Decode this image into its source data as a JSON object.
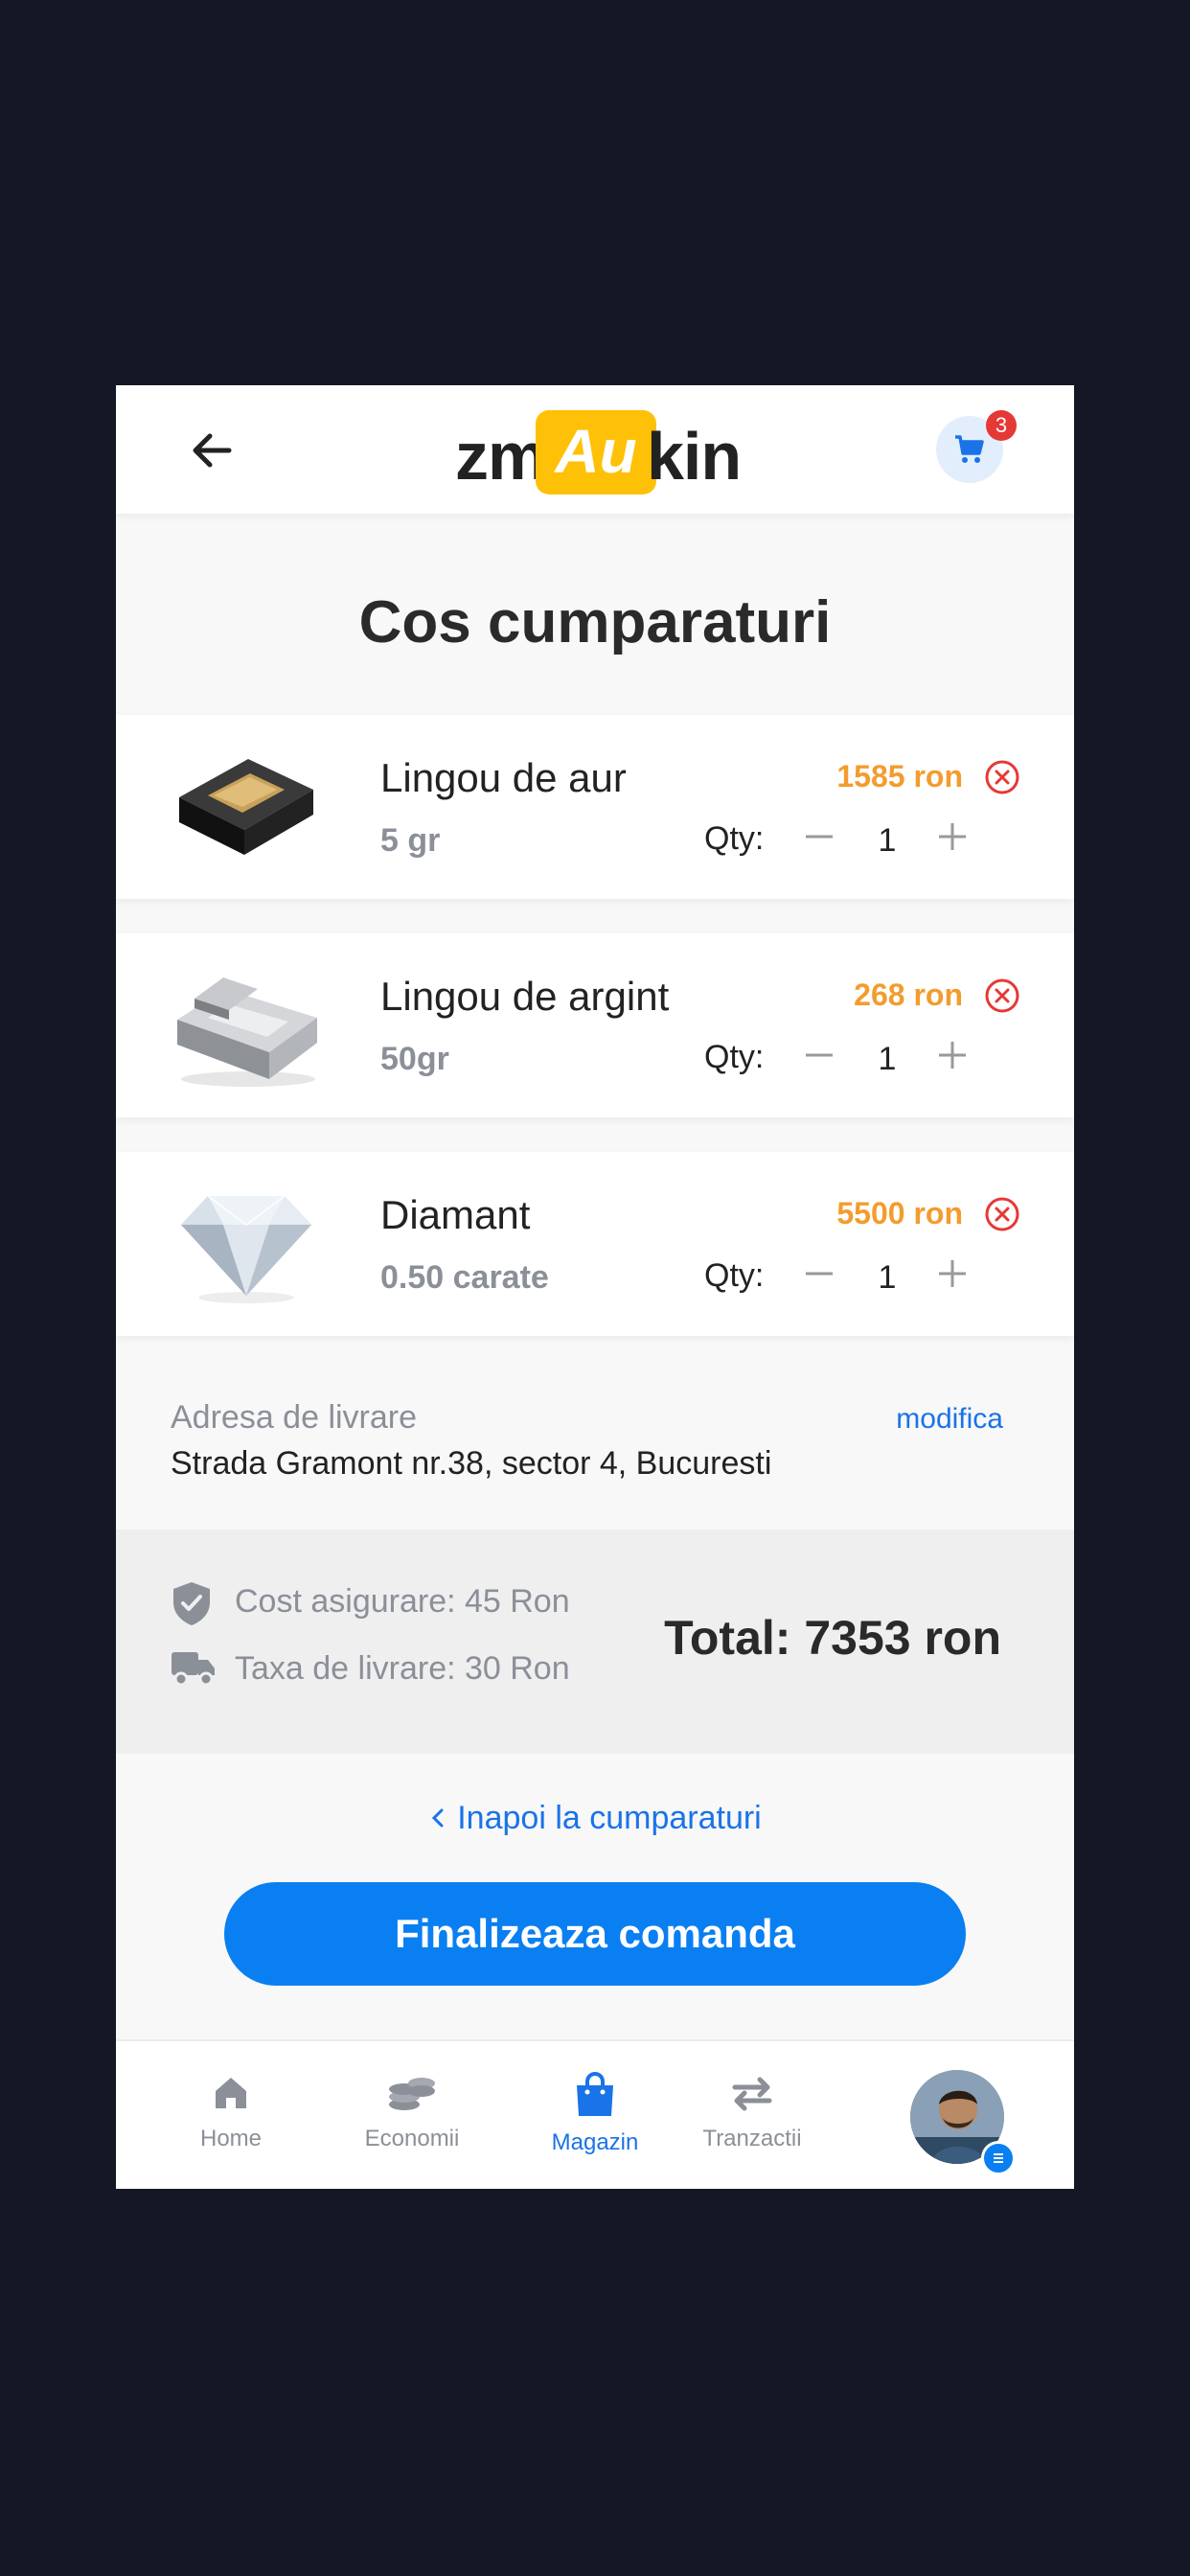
{
  "header": {
    "logo": {
      "left": "zm",
      "highlight": "Au",
      "right": "kin"
    },
    "cart_count": "3"
  },
  "page_title": "Cos cumparaturi",
  "cart_items": [
    {
      "name": "Lingou de aur",
      "detail": "5 gr",
      "price": "1585 ron",
      "qty_label": "Qty:",
      "qty": "1"
    },
    {
      "name": "Lingou de argint",
      "detail": "50gr",
      "price": "268 ron",
      "qty_label": "Qty:",
      "qty": "1"
    },
    {
      "name": "Diamant",
      "detail": "0.50 carate",
      "price": "5500 ron",
      "qty_label": "Qty:",
      "qty": "1"
    }
  ],
  "address": {
    "label": "Adresa de livrare",
    "edit_label": "modifica",
    "value": "Strada Gramont nr.38, sector 4, Bucuresti"
  },
  "summary": {
    "insurance": "Cost asigurare: 45 Ron",
    "delivery": "Taxa de livrare: 30 Ron",
    "total": "Total: 7353 ron"
  },
  "actions": {
    "back_link": "Inapoi la cumparaturi",
    "checkout": "Finalizeaza comanda"
  },
  "nav": [
    {
      "label": "Home",
      "icon": "home-icon"
    },
    {
      "label": "Economii",
      "icon": "coins-icon"
    },
    {
      "label": "Magazin",
      "icon": "shopping-bag-icon",
      "active": true
    },
    {
      "label": "Tranzactii",
      "icon": "transfer-arrows-icon"
    }
  ],
  "colors": {
    "accent": "#0a7ff2",
    "price": "#f39c2e",
    "logo_yellow": "#ffc107",
    "remove": "#e53935"
  }
}
